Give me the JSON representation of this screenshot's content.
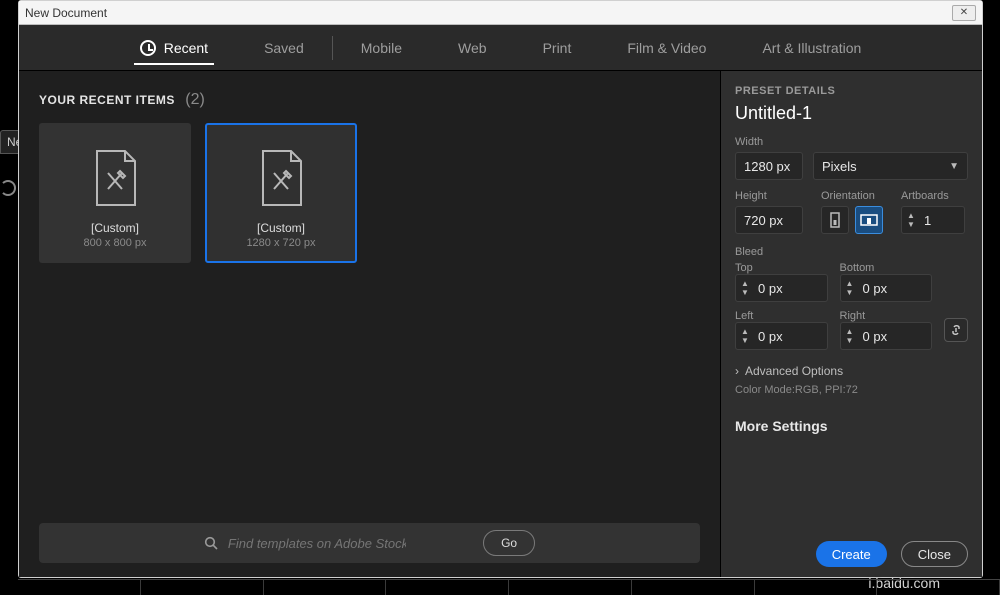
{
  "window": {
    "title": "New Document"
  },
  "tabs": {
    "recent": "Recent",
    "saved": "Saved",
    "mobile": "Mobile",
    "web": "Web",
    "print": "Print",
    "film": "Film & Video",
    "art": "Art & Illustration"
  },
  "left": {
    "heading": "YOUR RECENT ITEMS",
    "count": "(2)",
    "cards": [
      {
        "label": "[Custom]",
        "dim": "800 x 800 px"
      },
      {
        "label": "[Custom]",
        "dim": "1280 x 720 px"
      }
    ],
    "search_placeholder": "Find templates on Adobe Stock",
    "go": "Go"
  },
  "right": {
    "panel_title": "PRESET DETAILS",
    "name": "Untitled-1",
    "width_label": "Width",
    "width_value": "1280 px",
    "units": "Pixels",
    "height_label": "Height",
    "height_value": "720 px",
    "orientation_label": "Orientation",
    "artboards_label": "Artboards",
    "artboards_value": "1",
    "bleed_label": "Bleed",
    "top_label": "Top",
    "bottom_label": "Bottom",
    "left_label": "Left",
    "right_label": "Right",
    "bleed_value": "0 px",
    "advanced": "Advanced Options",
    "mode": "Color Mode:RGB, PPI:72",
    "more": "More Settings",
    "create": "Create",
    "close": "Close"
  },
  "behind": {
    "tab": "New"
  },
  "watermark": "i.baidu.com"
}
